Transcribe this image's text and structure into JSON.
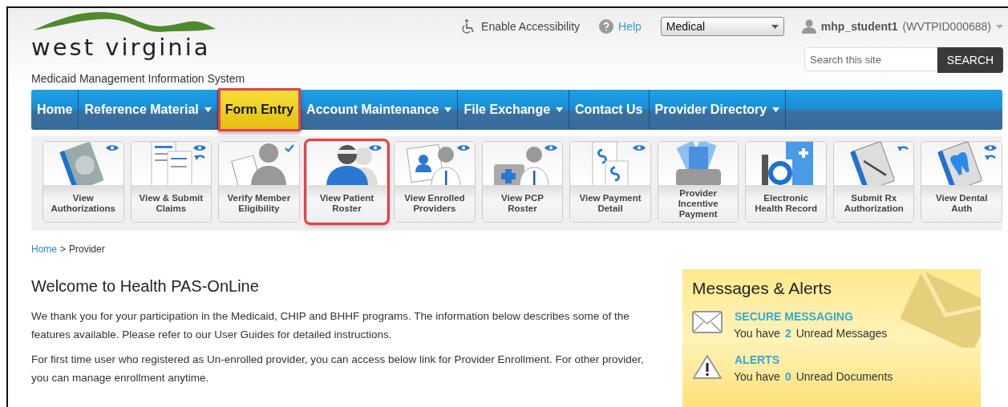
{
  "header": {
    "logo_text": "west virginia",
    "subtitle": "Medicaid Management Information System",
    "accessibility": "Enable Accessibility",
    "help": "Help",
    "program_select": "Medical",
    "user": {
      "name": "mhp_student1",
      "id": "(WVTPID000688)"
    },
    "search": {
      "placeholder": "Search this site",
      "button": "SEARCH"
    }
  },
  "nav": [
    {
      "label": "Home",
      "dropdown": false,
      "highlighted": false
    },
    {
      "label": "Reference Material",
      "dropdown": true,
      "highlighted": false
    },
    {
      "label": "Form Entry",
      "dropdown": false,
      "highlighted": true
    },
    {
      "label": "Account Maintenance",
      "dropdown": true,
      "highlighted": false
    },
    {
      "label": "File Exchange",
      "dropdown": true,
      "highlighted": false
    },
    {
      "label": "Contact Us",
      "dropdown": false,
      "highlighted": false
    },
    {
      "label": "Provider Directory",
      "dropdown": true,
      "highlighted": false
    }
  ],
  "tiles": [
    {
      "label": "View Authorizations",
      "view": true,
      "edit": false,
      "verified": false,
      "highlighted": false
    },
    {
      "label": "View & Submit Claims",
      "view": true,
      "edit": true,
      "verified": false,
      "highlighted": false
    },
    {
      "label": "Verify Member Eligibility",
      "view": false,
      "edit": false,
      "verified": true,
      "highlighted": false
    },
    {
      "label": "View Patient Roster",
      "view": true,
      "edit": false,
      "verified": false,
      "highlighted": true
    },
    {
      "label": "View Enrolled Providers",
      "view": true,
      "edit": false,
      "verified": false,
      "highlighted": false
    },
    {
      "label": "View PCP Roster",
      "view": true,
      "edit": false,
      "verified": false,
      "highlighted": false
    },
    {
      "label": "View Payment Detail",
      "view": true,
      "edit": false,
      "verified": false,
      "highlighted": false
    },
    {
      "label": "Provider Incentive Payment",
      "view": false,
      "edit": false,
      "verified": false,
      "highlighted": false
    },
    {
      "label": "Electronic Health Record",
      "view": false,
      "edit": false,
      "verified": false,
      "highlighted": false
    },
    {
      "label": "Submit Rx Authorization",
      "view": false,
      "edit": true,
      "verified": false,
      "highlighted": false
    },
    {
      "label": "View Dental Auth",
      "view": true,
      "edit": true,
      "verified": false,
      "highlighted": false
    }
  ],
  "breadcrumb": [
    {
      "label": "Home",
      "link": true
    },
    {
      "label": ">",
      "link": false
    },
    {
      "label": "Provider",
      "link": false
    }
  ],
  "welcome": {
    "title": "Welcome to Health PAS-OnLine",
    "paragraphs": [
      "We thank you for your participation in the Medicaid, CHIP and BHHF programs. The information below describes some of the features available. Please refer to our User Guides for detailed instructions.",
      "For first time user who registered as Un-enrolled provider, you can access below link for Provider Enrollment. For other provider, you can manage enrollment anytime."
    ]
  },
  "messages": {
    "title": "Messages & Alerts",
    "items": [
      {
        "kind": "mail",
        "title": "SECURE MESSAGING",
        "prefix": "You have",
        "count": "2",
        "suffix": "Unread Messages"
      },
      {
        "kind": "alert",
        "title": "ALERTS",
        "prefix": "You have",
        "count": "0",
        "suffix": "Unread Documents"
      }
    ]
  }
}
